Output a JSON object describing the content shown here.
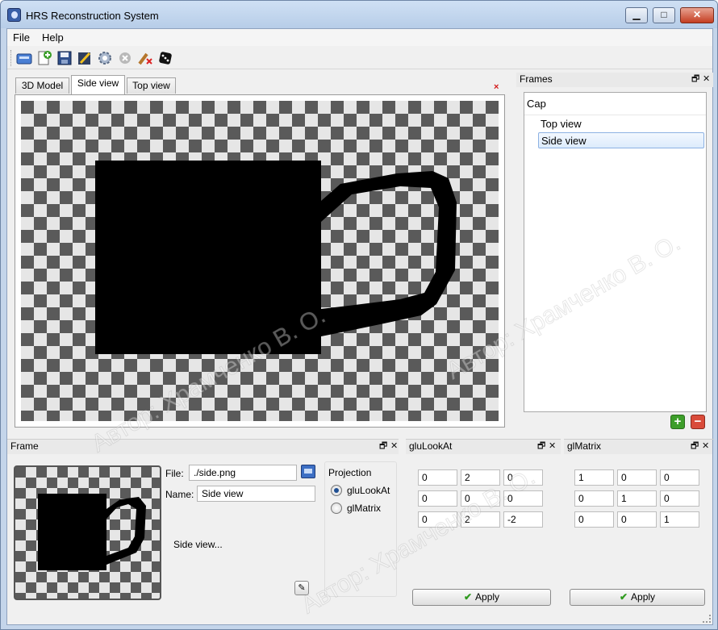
{
  "window": {
    "title": "HRS Reconstruction System",
    "min_label": "▁",
    "max_label": "□",
    "close_label": "✕"
  },
  "menu": {
    "file": "File",
    "help": "Help"
  },
  "toolbar": {
    "icons": [
      "new-icon",
      "add-icon",
      "save-icon",
      "edit-icon",
      "settings-icon",
      "cancel-icon",
      "clear-icon",
      "random-icon"
    ]
  },
  "tabs": {
    "items": [
      "3D Model",
      "Side view",
      "Top view"
    ],
    "active": "Side view",
    "close_label": "×"
  },
  "frames": {
    "title": "Frames",
    "float_label": "🗗",
    "close_label": "✕",
    "root": "Cap",
    "items": [
      "Top view",
      "Side view"
    ],
    "selected": "Side view",
    "add_label": "+",
    "remove_label": "−"
  },
  "frame": {
    "title": "Frame",
    "float_label": "🗗",
    "close_label": "✕",
    "file_label": "File:",
    "file_value": "./side.png",
    "name_label": "Name:",
    "name_value": "Side view",
    "description": "Side view...",
    "projection_title": "Projection",
    "projection_options": [
      "gluLookAt",
      "glMatrix"
    ],
    "projection_selected": "gluLookAt",
    "tool_label": "✎"
  },
  "glulookat": {
    "title": "gluLookAt",
    "float_label": "🗗",
    "close_label": "✕",
    "rows": [
      [
        "0",
        "2",
        "0"
      ],
      [
        "0",
        "0",
        "0"
      ],
      [
        "0",
        "2",
        "-2"
      ]
    ],
    "apply_label": "Apply",
    "apply_check": "✔"
  },
  "glmatrix": {
    "title": "glMatrix",
    "float_label": "🗗",
    "close_label": "✕",
    "rows": [
      [
        "1",
        "0",
        "0"
      ],
      [
        "0",
        "1",
        "0"
      ],
      [
        "0",
        "0",
        "1"
      ]
    ],
    "apply_label": "Apply",
    "apply_check": "✔"
  },
  "watermark": "Автор: Храмченко В. О."
}
